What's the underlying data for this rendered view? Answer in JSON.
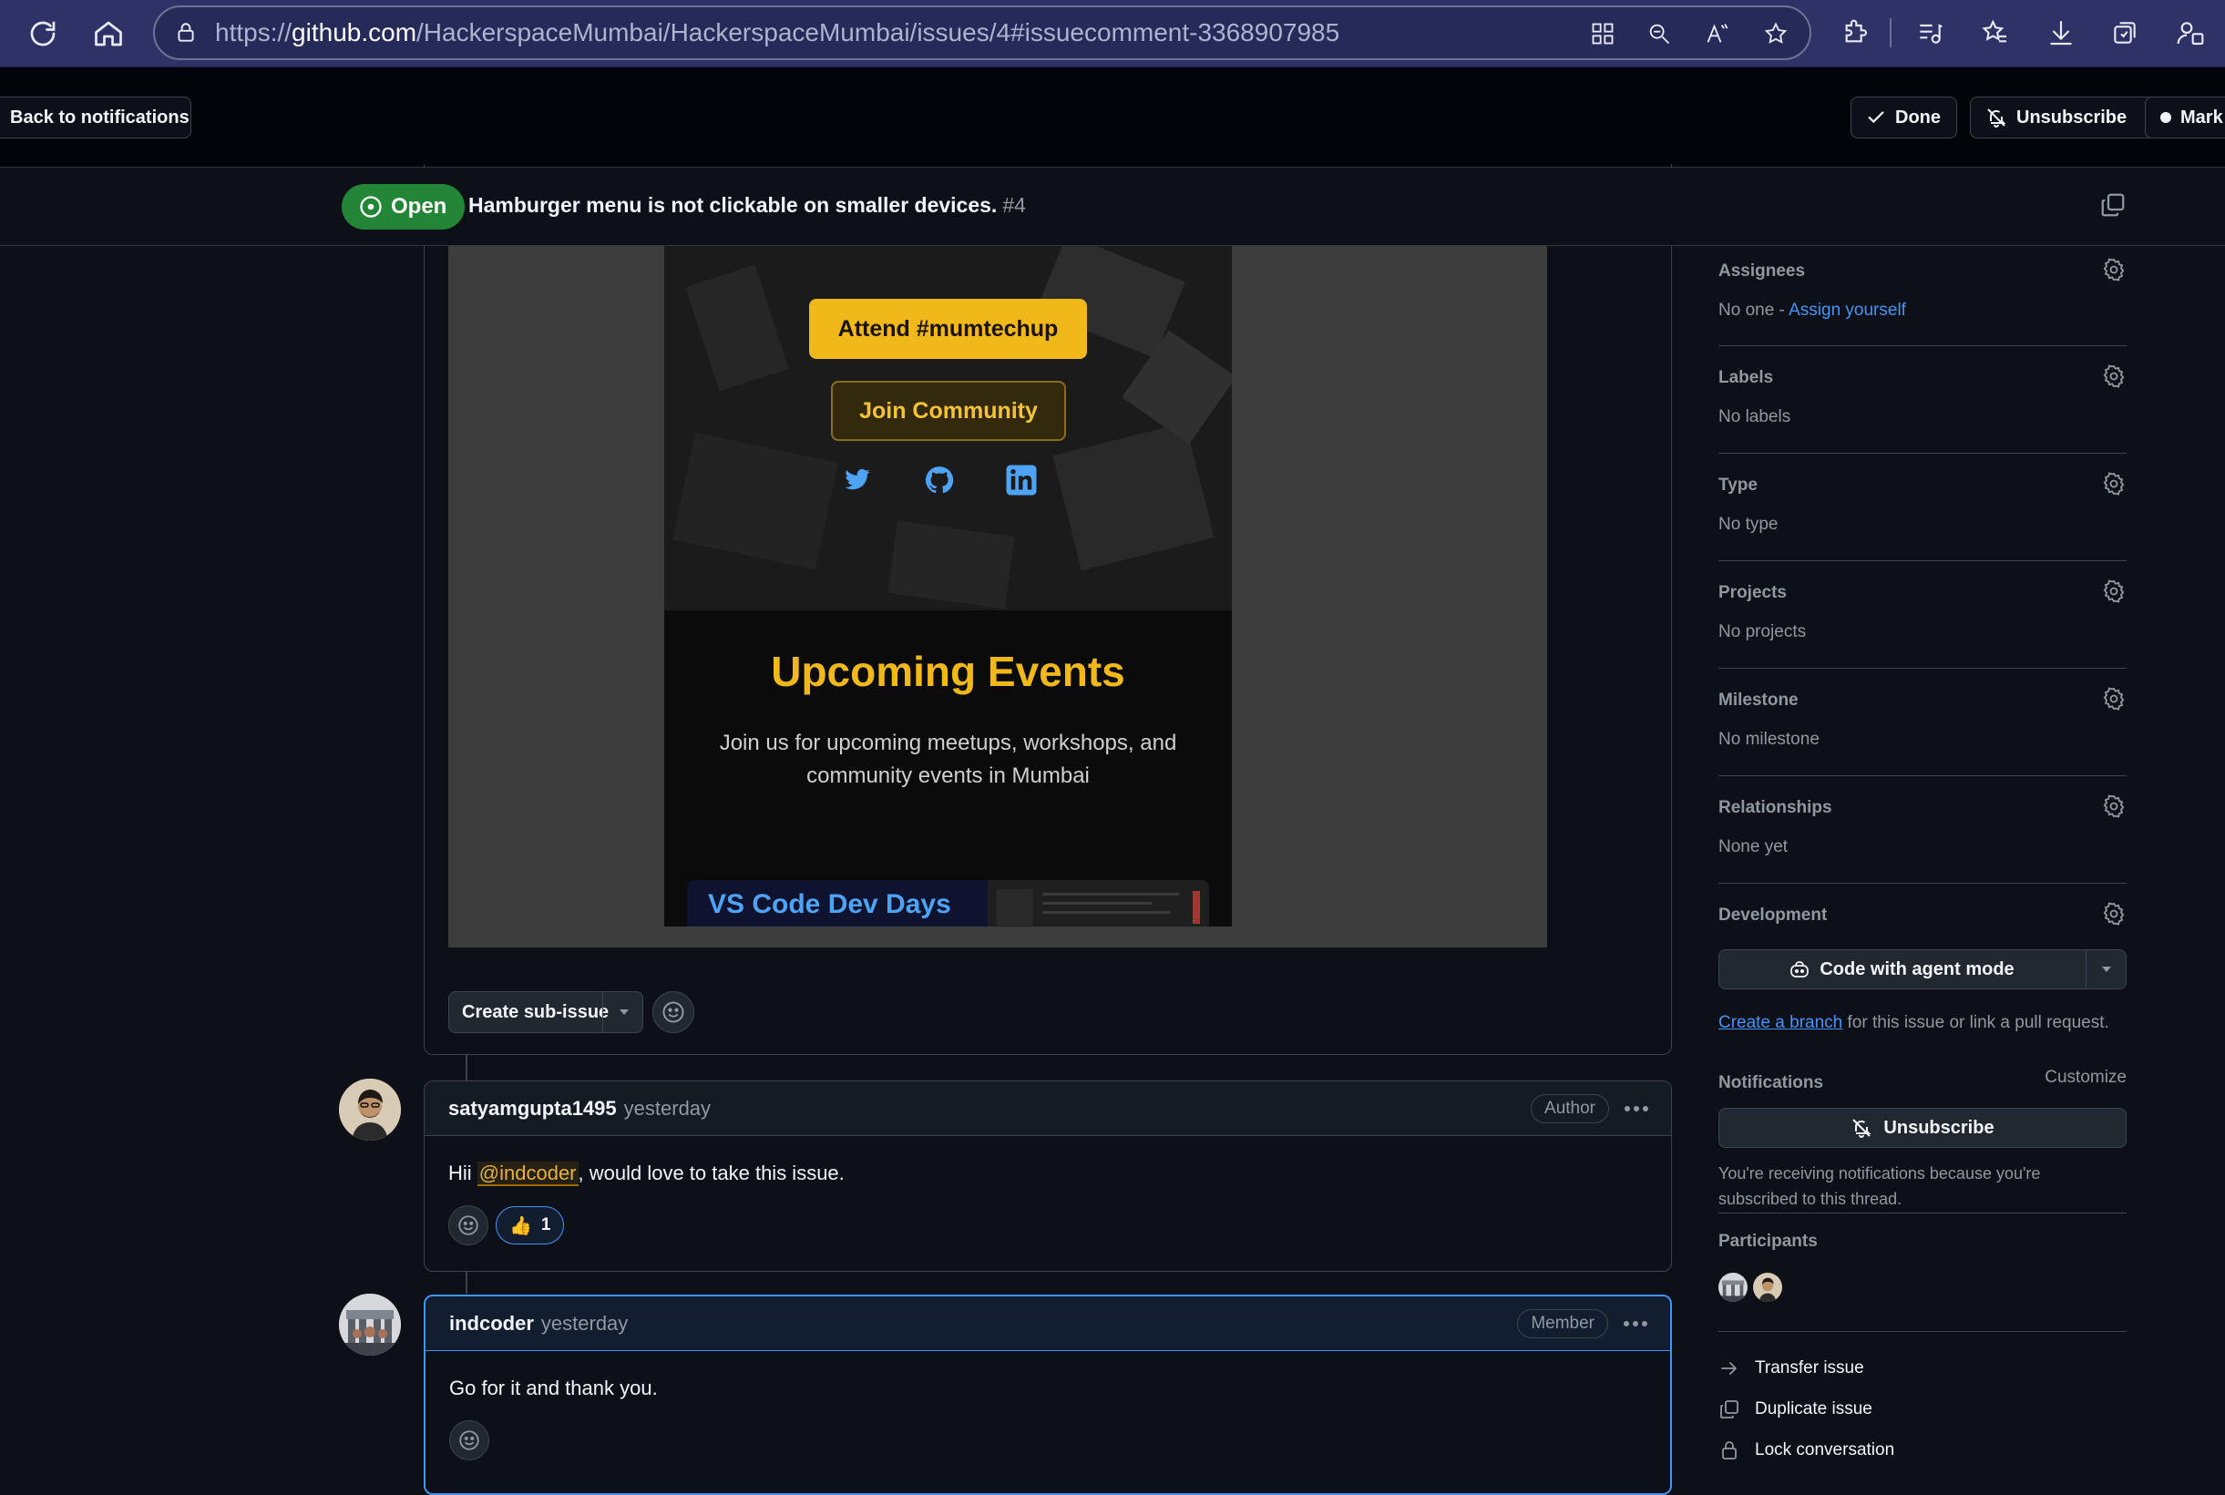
{
  "browser": {
    "url_prefix": "https://",
    "url_domain": "github.com",
    "url_path": "/HackerspaceMumbai/HackerspaceMumbai/issues/4#issuecomment-3368907985"
  },
  "notifications_bar": {
    "back_label": "Back to notifications",
    "done_label": "Done",
    "unsubscribe_label": "Unsubscribe",
    "mark_label": "Mark"
  },
  "issue": {
    "state": "Open",
    "title": "Hamburger menu is not clickable on smaller devices.",
    "number": "#4"
  },
  "preview": {
    "attend_label": "Attend #mumtechup",
    "join_label": "Join Community",
    "events_title": "Upcoming Events",
    "events_description": "Join us for upcoming meetups, workshops, and community events in Mumbai",
    "event_card_title": "VS Code Dev Days"
  },
  "issue_actions": {
    "create_subissue_label": "Create sub-issue"
  },
  "comments": [
    {
      "author": "satyamgupta1495",
      "time": "yesterday",
      "role": "Author",
      "text_before": "Hii ",
      "mention": "@indcoder",
      "text_after": ", would love to take this issue.",
      "reaction_emoji": "👍",
      "reaction_count": "1"
    },
    {
      "author": "indcoder",
      "time": "yesterday",
      "role": "Member",
      "text": "Go for it and thank you."
    }
  ],
  "sidebar": {
    "assignees": {
      "title": "Assignees",
      "value": "No one - ",
      "link": "Assign yourself"
    },
    "labels": {
      "title": "Labels",
      "value": "No labels"
    },
    "type": {
      "title": "Type",
      "value": "No type"
    },
    "projects": {
      "title": "Projects",
      "value": "No projects"
    },
    "milestone": {
      "title": "Milestone",
      "value": "No milestone"
    },
    "relationships": {
      "title": "Relationships",
      "value": "None yet"
    },
    "development": {
      "title": "Development",
      "button_label": "Code with agent mode",
      "link": "Create a branch",
      "text": " for this issue or link a pull request."
    },
    "notifications": {
      "title": "Notifications",
      "customize_label": "Customize",
      "button_label": "Unsubscribe",
      "description": "You're receiving notifications because you're subscribed to this thread."
    },
    "participants": {
      "title": "Participants"
    },
    "actions": [
      "Transfer issue",
      "Duplicate issue",
      "Lock conversation"
    ]
  },
  "colors": {
    "open_green": "#238636",
    "accent_blue": "#4493f8",
    "brand_yellow": "#f0b819"
  }
}
